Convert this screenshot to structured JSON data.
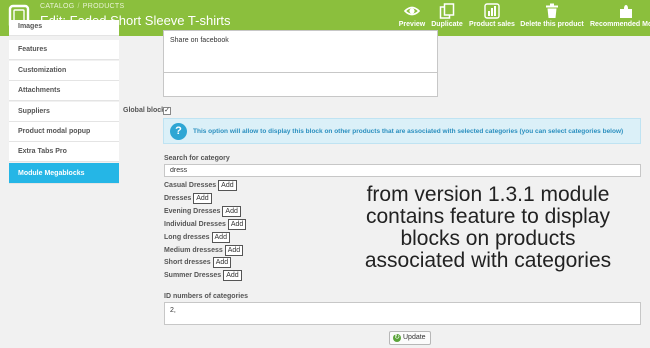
{
  "header": {
    "breadcrumb": [
      "CATALOG",
      "PRODUCTS"
    ],
    "breadcrumb_sep": "/",
    "title": "Edit: Faded Short Sleeve T-shirts",
    "toolbar": [
      {
        "label": "Preview",
        "icon": "eye-icon"
      },
      {
        "label": "Duplicate",
        "icon": "copy-icon"
      },
      {
        "label": "Product sales",
        "icon": "bar-chart-icon"
      },
      {
        "label": "Delete this product",
        "icon": "trash-icon"
      },
      {
        "label": "Recommended Mo",
        "icon": "puzzle-icon"
      }
    ],
    "color": "#8bbf3d"
  },
  "sidebar": {
    "items": [
      {
        "label": "Images"
      },
      {
        "label": "Features"
      },
      {
        "label": "Customization"
      },
      {
        "label": "Attachments"
      },
      {
        "label": "Suppliers"
      },
      {
        "label": "Product modal popup"
      },
      {
        "label": "Extra Tabs Pro"
      },
      {
        "label": "Module Megablocks",
        "active": true
      }
    ],
    "active_color": "#25b6e6"
  },
  "main": {
    "block_text": "Share on facebook",
    "global_block_label": "Global block",
    "global_block_checked": true,
    "info_text": "This option will allow to display this block on other products that are associated with selected categories (you can select categories below)",
    "search_label": "Search for category",
    "search_value": "dress",
    "add_label": "Add",
    "categories": [
      {
        "name": "Casual Dresses"
      },
      {
        "name": "Dresses"
      },
      {
        "name": "Evening Dresses"
      },
      {
        "name": "Individual Dresses"
      },
      {
        "name": "Long dresses"
      },
      {
        "name": "Medium dressess"
      },
      {
        "name": "Short dresses"
      },
      {
        "name": "Summer Dresses"
      }
    ],
    "overlay_lines": [
      "from version 1.3.1 module",
      "contains feature to display",
      "blocks on products",
      "associated with categories"
    ],
    "ids_label": "ID numbers of categories",
    "ids_value": "2,",
    "update_label": "Update"
  }
}
